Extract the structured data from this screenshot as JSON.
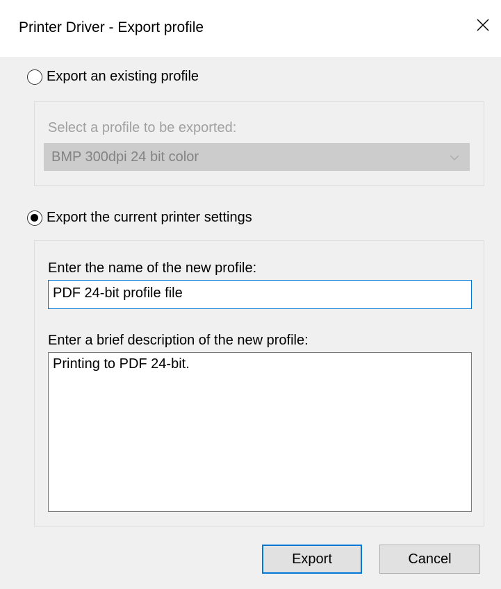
{
  "window": {
    "title": "Printer Driver - Export profile"
  },
  "export_existing": {
    "label": "Export an existing profile",
    "checked": false,
    "select_label": "Select a profile to be exported:",
    "selected_profile": "BMP 300dpi 24 bit color"
  },
  "export_current": {
    "label": "Export the current printer settings",
    "checked": true,
    "name_label": "Enter the name of the new profile:",
    "name_value": "PDF 24-bit profile file",
    "description_label": "Enter a brief description of the new profile:",
    "description_value": "Printing to PDF 24-bit."
  },
  "buttons": {
    "export": "Export",
    "cancel": "Cancel"
  },
  "icons": {
    "close": "close-icon",
    "dropdown": "chevron-down-icon"
  },
  "colors": {
    "accent": "#0078d7",
    "window_bg": "#f0f0f0",
    "disabled_text": "#a0a0a0"
  }
}
